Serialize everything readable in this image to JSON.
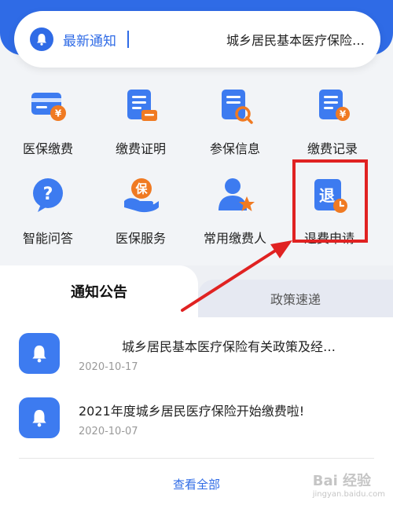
{
  "notice_bar": {
    "title": "最新通知",
    "text": "城乡居民基本医疗保险…"
  },
  "services": [
    {
      "label": "医保缴费",
      "icon": "card-yuan-icon"
    },
    {
      "label": "缴费证明",
      "icon": "document-card-icon"
    },
    {
      "label": "参保信息",
      "icon": "document-search-icon"
    },
    {
      "label": "缴费记录",
      "icon": "document-yuan-icon"
    },
    {
      "label": "智能问答",
      "icon": "question-bubble-icon"
    },
    {
      "label": "医保服务",
      "icon": "hand-protect-icon"
    },
    {
      "label": "常用缴费人",
      "icon": "person-star-icon"
    },
    {
      "label": "退费申请",
      "icon": "refund-document-icon"
    }
  ],
  "refund_icon_char": "退",
  "protect_icon_char": "保",
  "tabs": {
    "active": "通知公告",
    "inactive": "政策速递"
  },
  "news": [
    {
      "title": "城乡居民基本医疗保险有关政策及经…",
      "date": "2020-10-17"
    },
    {
      "title": "2021年度城乡居民医疗保险开始缴费啦!",
      "date": "2020-10-07"
    }
  ],
  "view_all": "查看全部",
  "watermark": {
    "main": "Bai 经验",
    "sub": "jingyan.baidu.com"
  },
  "colors": {
    "primary": "#2f6be6",
    "highlight": "#e02222",
    "accent_orange": "#f07a22"
  }
}
